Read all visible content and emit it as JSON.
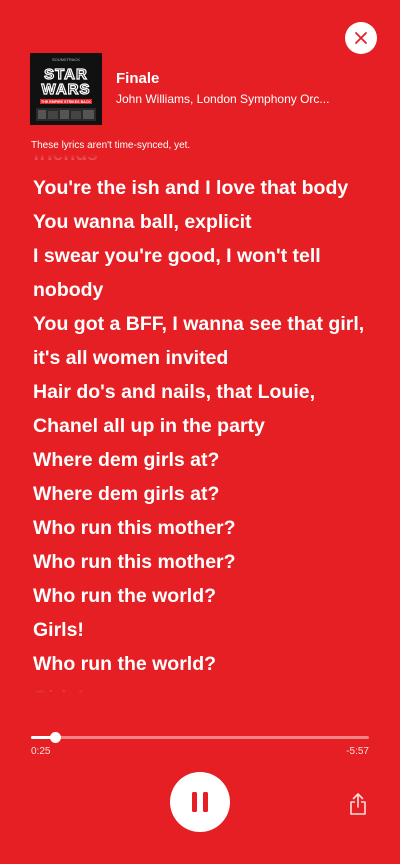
{
  "colors": {
    "background": "#e51f23",
    "text": "#ffffff",
    "control": "#ffffff",
    "control_icon": "#e51f23"
  },
  "track": {
    "title": "Finale",
    "artist": "John Williams, London Symphony Orc...",
    "album_art": {
      "header": "SOUNDTRACK",
      "logo_line1": "STAR",
      "logo_line2": "WARS",
      "subtitle": "THE EMPIRE STRIKES BACK"
    }
  },
  "lyrics": {
    "sync_note": "These lyrics aren't time-synced, yet.",
    "lines": [
      "friends",
      "You're the ish and I love that body",
      "You wanna ball, explicit",
      "I swear you're good, I won't tell",
      "nobody",
      "You got a BFF, I wanna see that girl,",
      "it's all women invited",
      "Hair do's and nails, that Louie,",
      "Chanel all up in the party",
      "Where dem girls at?",
      "Where dem girls at?",
      "Who run this mother?",
      "Who run this mother?",
      "Who run the world?",
      "Girls!",
      "Who run the world?",
      "Girls!"
    ]
  },
  "player": {
    "elapsed": "0:25",
    "remaining": "-5:57",
    "progress_fraction": 0.07,
    "state": "playing",
    "play_pause_icon": "pause-icon",
    "share_icon": "share-icon",
    "close_icon": "close-icon"
  }
}
